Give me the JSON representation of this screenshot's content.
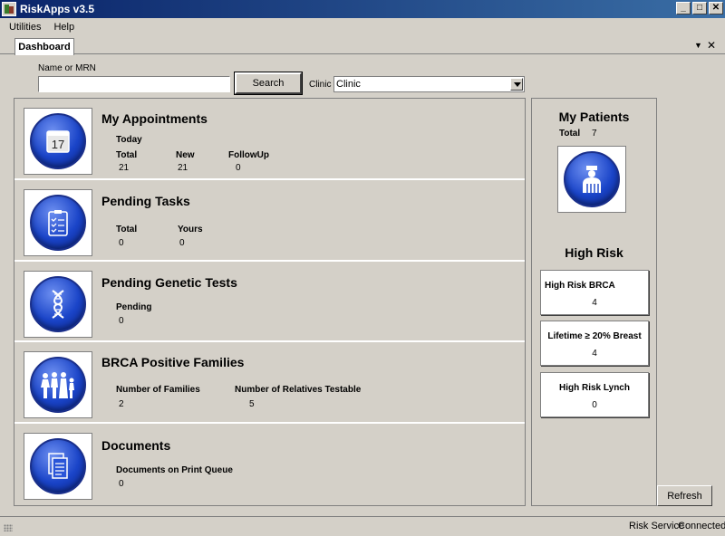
{
  "window": {
    "title": "RiskApps v3.5"
  },
  "menu": {
    "items": [
      "Utilities",
      "Help"
    ]
  },
  "tabs": {
    "active": "Dashboard"
  },
  "search": {
    "label": "Name or MRN",
    "value": "",
    "button": "Search",
    "clinic_label": "Clinic",
    "clinic_value": "Clinic"
  },
  "appointments": {
    "title": "My Appointments",
    "subtitle": "Today",
    "total_label": "Total",
    "total": "21",
    "new_label": "New",
    "new": "21",
    "followup_label": "FollowUp",
    "followup": "0",
    "day": "17"
  },
  "tasks": {
    "title": "Pending Tasks",
    "total_label": "Total",
    "total": "0",
    "yours_label": "Yours",
    "yours": "0"
  },
  "genetic": {
    "title": "Pending Genetic Tests",
    "pending_label": "Pending",
    "pending": "0"
  },
  "brca": {
    "title": "BRCA Positive Families",
    "families_label": "Number of Families",
    "families": "2",
    "relatives_label": "Number of Relatives Testable",
    "relatives": "5"
  },
  "documents": {
    "title": "Documents",
    "queue_label": "Documents on Print Queue",
    "queue": "0"
  },
  "patients": {
    "title": "My Patients",
    "total_label": "Total",
    "total": "7"
  },
  "high_risk": {
    "title": "High Risk",
    "items": [
      {
        "label": "High Risk BRCA",
        "value": "4"
      },
      {
        "label": "Lifetime ≥ 20% Breast",
        "value": "4"
      },
      {
        "label": "High Risk Lynch",
        "value": "0"
      }
    ]
  },
  "refresh": {
    "label": "Refresh"
  },
  "status": {
    "service_label": "Risk Service",
    "state": "Connected"
  }
}
